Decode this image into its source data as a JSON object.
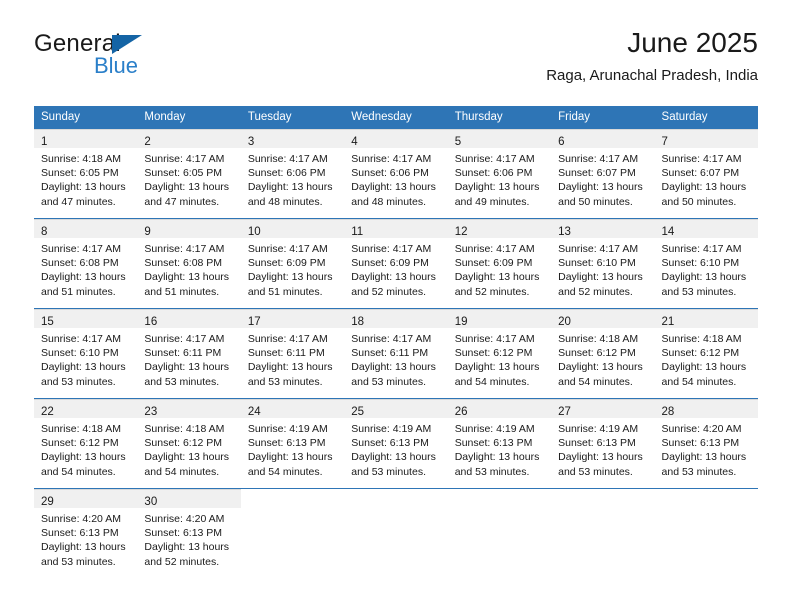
{
  "brand": {
    "name_top": "General",
    "name_bottom": "Blue",
    "accent_color": "#2a7fc9",
    "triangle_color": "#1464a5"
  },
  "header": {
    "title": "June 2025",
    "subtitle": "Raga, Arunachal Pradesh, India"
  },
  "theme": {
    "header_blue": "#2e75b6",
    "daynum_band": "#f0f0f0",
    "grid_line": "#d9d9d9"
  },
  "weekdays": [
    "Sunday",
    "Monday",
    "Tuesday",
    "Wednesday",
    "Thursday",
    "Friday",
    "Saturday"
  ],
  "weeks": [
    [
      {
        "day": "1",
        "sunrise": "Sunrise: 4:18 AM",
        "sunset": "Sunset: 6:05 PM",
        "daylight1": "Daylight: 13 hours",
        "daylight2": "and 47 minutes."
      },
      {
        "day": "2",
        "sunrise": "Sunrise: 4:17 AM",
        "sunset": "Sunset: 6:05 PM",
        "daylight1": "Daylight: 13 hours",
        "daylight2": "and 47 minutes."
      },
      {
        "day": "3",
        "sunrise": "Sunrise: 4:17 AM",
        "sunset": "Sunset: 6:06 PM",
        "daylight1": "Daylight: 13 hours",
        "daylight2": "and 48 minutes."
      },
      {
        "day": "4",
        "sunrise": "Sunrise: 4:17 AM",
        "sunset": "Sunset: 6:06 PM",
        "daylight1": "Daylight: 13 hours",
        "daylight2": "and 48 minutes."
      },
      {
        "day": "5",
        "sunrise": "Sunrise: 4:17 AM",
        "sunset": "Sunset: 6:06 PM",
        "daylight1": "Daylight: 13 hours",
        "daylight2": "and 49 minutes."
      },
      {
        "day": "6",
        "sunrise": "Sunrise: 4:17 AM",
        "sunset": "Sunset: 6:07 PM",
        "daylight1": "Daylight: 13 hours",
        "daylight2": "and 50 minutes."
      },
      {
        "day": "7",
        "sunrise": "Sunrise: 4:17 AM",
        "sunset": "Sunset: 6:07 PM",
        "daylight1": "Daylight: 13 hours",
        "daylight2": "and 50 minutes."
      }
    ],
    [
      {
        "day": "8",
        "sunrise": "Sunrise: 4:17 AM",
        "sunset": "Sunset: 6:08 PM",
        "daylight1": "Daylight: 13 hours",
        "daylight2": "and 51 minutes."
      },
      {
        "day": "9",
        "sunrise": "Sunrise: 4:17 AM",
        "sunset": "Sunset: 6:08 PM",
        "daylight1": "Daylight: 13 hours",
        "daylight2": "and 51 minutes."
      },
      {
        "day": "10",
        "sunrise": "Sunrise: 4:17 AM",
        "sunset": "Sunset: 6:09 PM",
        "daylight1": "Daylight: 13 hours",
        "daylight2": "and 51 minutes."
      },
      {
        "day": "11",
        "sunrise": "Sunrise: 4:17 AM",
        "sunset": "Sunset: 6:09 PM",
        "daylight1": "Daylight: 13 hours",
        "daylight2": "and 52 minutes."
      },
      {
        "day": "12",
        "sunrise": "Sunrise: 4:17 AM",
        "sunset": "Sunset: 6:09 PM",
        "daylight1": "Daylight: 13 hours",
        "daylight2": "and 52 minutes."
      },
      {
        "day": "13",
        "sunrise": "Sunrise: 4:17 AM",
        "sunset": "Sunset: 6:10 PM",
        "daylight1": "Daylight: 13 hours",
        "daylight2": "and 52 minutes."
      },
      {
        "day": "14",
        "sunrise": "Sunrise: 4:17 AM",
        "sunset": "Sunset: 6:10 PM",
        "daylight1": "Daylight: 13 hours",
        "daylight2": "and 53 minutes."
      }
    ],
    [
      {
        "day": "15",
        "sunrise": "Sunrise: 4:17 AM",
        "sunset": "Sunset: 6:10 PM",
        "daylight1": "Daylight: 13 hours",
        "daylight2": "and 53 minutes."
      },
      {
        "day": "16",
        "sunrise": "Sunrise: 4:17 AM",
        "sunset": "Sunset: 6:11 PM",
        "daylight1": "Daylight: 13 hours",
        "daylight2": "and 53 minutes."
      },
      {
        "day": "17",
        "sunrise": "Sunrise: 4:17 AM",
        "sunset": "Sunset: 6:11 PM",
        "daylight1": "Daylight: 13 hours",
        "daylight2": "and 53 minutes."
      },
      {
        "day": "18",
        "sunrise": "Sunrise: 4:17 AM",
        "sunset": "Sunset: 6:11 PM",
        "daylight1": "Daylight: 13 hours",
        "daylight2": "and 53 minutes."
      },
      {
        "day": "19",
        "sunrise": "Sunrise: 4:17 AM",
        "sunset": "Sunset: 6:12 PM",
        "daylight1": "Daylight: 13 hours",
        "daylight2": "and 54 minutes."
      },
      {
        "day": "20",
        "sunrise": "Sunrise: 4:18 AM",
        "sunset": "Sunset: 6:12 PM",
        "daylight1": "Daylight: 13 hours",
        "daylight2": "and 54 minutes."
      },
      {
        "day": "21",
        "sunrise": "Sunrise: 4:18 AM",
        "sunset": "Sunset: 6:12 PM",
        "daylight1": "Daylight: 13 hours",
        "daylight2": "and 54 minutes."
      }
    ],
    [
      {
        "day": "22",
        "sunrise": "Sunrise: 4:18 AM",
        "sunset": "Sunset: 6:12 PM",
        "daylight1": "Daylight: 13 hours",
        "daylight2": "and 54 minutes."
      },
      {
        "day": "23",
        "sunrise": "Sunrise: 4:18 AM",
        "sunset": "Sunset: 6:12 PM",
        "daylight1": "Daylight: 13 hours",
        "daylight2": "and 54 minutes."
      },
      {
        "day": "24",
        "sunrise": "Sunrise: 4:19 AM",
        "sunset": "Sunset: 6:13 PM",
        "daylight1": "Daylight: 13 hours",
        "daylight2": "and 54 minutes."
      },
      {
        "day": "25",
        "sunrise": "Sunrise: 4:19 AM",
        "sunset": "Sunset: 6:13 PM",
        "daylight1": "Daylight: 13 hours",
        "daylight2": "and 53 minutes."
      },
      {
        "day": "26",
        "sunrise": "Sunrise: 4:19 AM",
        "sunset": "Sunset: 6:13 PM",
        "daylight1": "Daylight: 13 hours",
        "daylight2": "and 53 minutes."
      },
      {
        "day": "27",
        "sunrise": "Sunrise: 4:19 AM",
        "sunset": "Sunset: 6:13 PM",
        "daylight1": "Daylight: 13 hours",
        "daylight2": "and 53 minutes."
      },
      {
        "day": "28",
        "sunrise": "Sunrise: 4:20 AM",
        "sunset": "Sunset: 6:13 PM",
        "daylight1": "Daylight: 13 hours",
        "daylight2": "and 53 minutes."
      }
    ],
    [
      {
        "day": "29",
        "sunrise": "Sunrise: 4:20 AM",
        "sunset": "Sunset: 6:13 PM",
        "daylight1": "Daylight: 13 hours",
        "daylight2": "and 53 minutes."
      },
      {
        "day": "30",
        "sunrise": "Sunrise: 4:20 AM",
        "sunset": "Sunset: 6:13 PM",
        "daylight1": "Daylight: 13 hours",
        "daylight2": "and 52 minutes."
      },
      {
        "day": "",
        "sunrise": "",
        "sunset": "",
        "daylight1": "",
        "daylight2": ""
      },
      {
        "day": "",
        "sunrise": "",
        "sunset": "",
        "daylight1": "",
        "daylight2": ""
      },
      {
        "day": "",
        "sunrise": "",
        "sunset": "",
        "daylight1": "",
        "daylight2": ""
      },
      {
        "day": "",
        "sunrise": "",
        "sunset": "",
        "daylight1": "",
        "daylight2": ""
      },
      {
        "day": "",
        "sunrise": "",
        "sunset": "",
        "daylight1": "",
        "daylight2": ""
      }
    ]
  ]
}
